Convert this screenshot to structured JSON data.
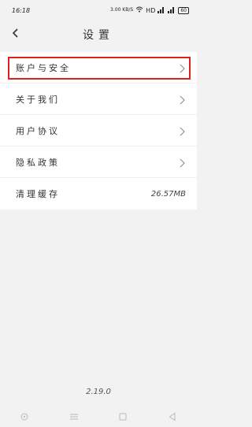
{
  "status_bar": {
    "time": "16:18",
    "speed": "3.00\nKB/S",
    "network": "HD",
    "signal_label_1": "5G",
    "signal_label_2": "5G",
    "battery": "60"
  },
  "header": {
    "title": "设置"
  },
  "settings": {
    "items": [
      {
        "label": "账户与安全",
        "value": ""
      },
      {
        "label": "关于我们",
        "value": ""
      },
      {
        "label": "用户协议",
        "value": ""
      },
      {
        "label": "隐私政策",
        "value": ""
      },
      {
        "label": "清理缓存",
        "value": "26.57MB"
      }
    ]
  },
  "footer": {
    "version": "2.19.0"
  },
  "colors": {
    "highlight": "#e0201c"
  }
}
